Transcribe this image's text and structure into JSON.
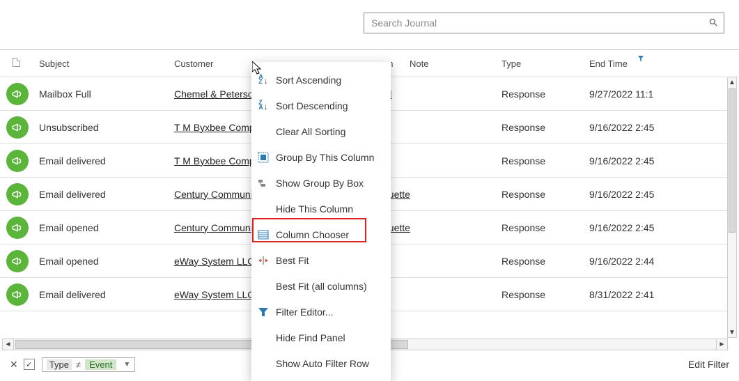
{
  "search": {
    "placeholder": "Search Journal"
  },
  "columns": {
    "subject": "Subject",
    "customer": "Customer",
    "super_fragment": "on",
    "note": "Note",
    "type": "Type",
    "endtime": "End Time"
  },
  "rows": [
    {
      "subject": "Mailbox Full",
      "customer": "Chemel & Peterso",
      "super": "rd",
      "type": "Response",
      "endtime": "9/27/2022 11:1"
    },
    {
      "subject": "Unsubscribed",
      "customer": "T M Byxbee Comp",
      "super": "",
      "type": "Response",
      "endtime": "9/16/2022 2:45"
    },
    {
      "subject": "Email delivered",
      "customer": "T M Byxbee Comp",
      "super": "",
      "type": "Response",
      "endtime": "9/16/2022 2:45"
    },
    {
      "subject": "Email delivered",
      "customer": "Century Communi",
      "super": "quette",
      "type": "Response",
      "endtime": "9/16/2022 2:45"
    },
    {
      "subject": "Email opened",
      "customer": "Century Communi",
      "super": "quette",
      "type": "Response",
      "endtime": "9/16/2022 2:45"
    },
    {
      "subject": "Email opened",
      "customer": "eWay System LLC",
      "super": "",
      "type": "Response",
      "endtime": "9/16/2022 2:44"
    },
    {
      "subject": "Email delivered",
      "customer": "eWay System LLC",
      "super": "",
      "type": "Response",
      "endtime": "8/31/2022 2:41"
    }
  ],
  "context_menu": {
    "sort_asc": "Sort Ascending",
    "sort_desc": "Sort Descending",
    "clear_sort": "Clear All Sorting",
    "group_by": "Group By This Column",
    "show_groupbox": "Show Group By Box",
    "hide_col": "Hide This Column",
    "col_chooser": "Column Chooser",
    "best_fit": "Best Fit",
    "best_fit_all": "Best Fit (all columns)",
    "filter_editor": "Filter Editor...",
    "hide_find": "Hide Find Panel",
    "auto_filter": "Show Auto Filter Row"
  },
  "footer": {
    "field": "Type",
    "op": "≠",
    "value": "Event",
    "edit": "Edit Filter"
  }
}
